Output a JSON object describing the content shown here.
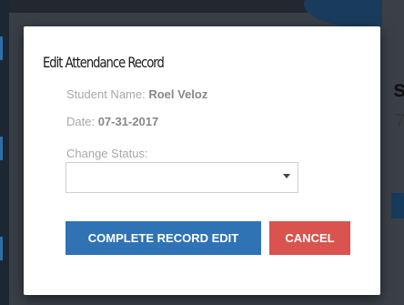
{
  "background": {
    "partial_heading_char": "s",
    "partial_digit": "7"
  },
  "modal": {
    "title": "Edit Attendance Record",
    "student_label": "Student Name: ",
    "student_value": "Roel Veloz",
    "date_label": "Date: ",
    "date_value": "07-31-2017",
    "change_status_label": "Change Status:",
    "status_select": {
      "selected": "",
      "icon": "chevron-down-icon"
    },
    "buttons": {
      "complete_label": "COMPLETE RECORD EDIT",
      "cancel_label": "CANCEL"
    }
  },
  "colors": {
    "primary_button": "#2f73b5",
    "danger_button": "#d9534f",
    "modal_background": "#ffffff",
    "backdrop": "#3a3f47"
  }
}
